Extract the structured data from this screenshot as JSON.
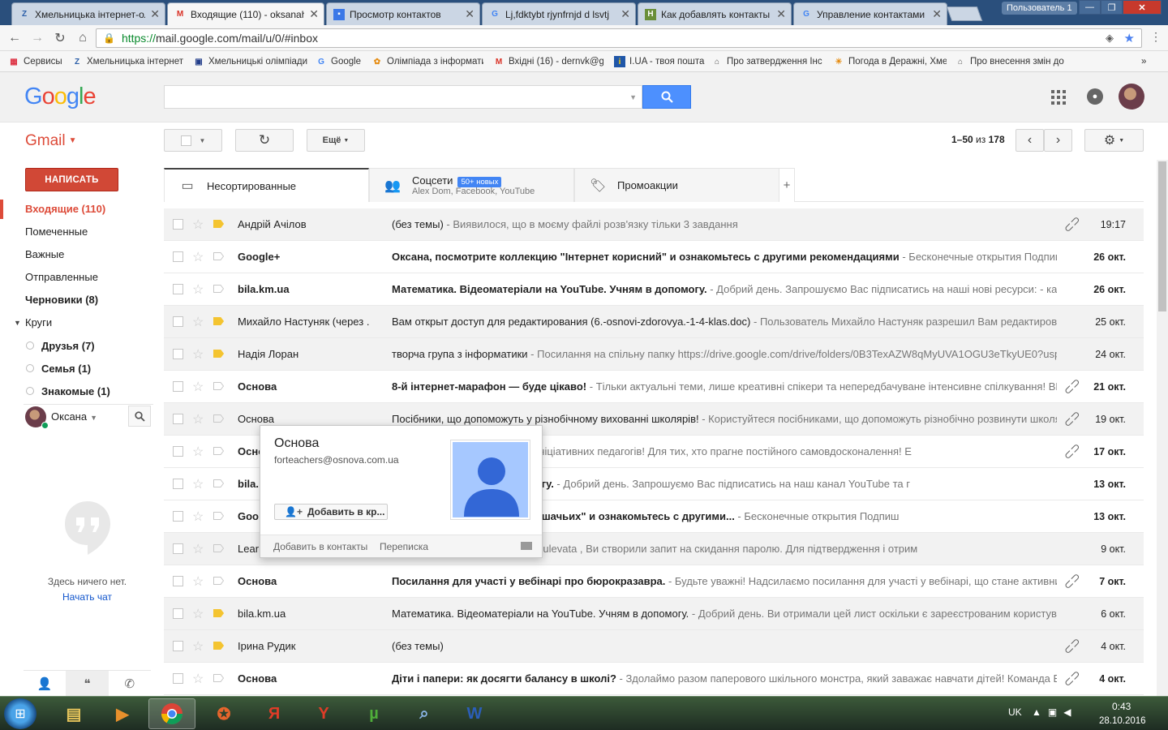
{
  "browser": {
    "tabs": [
      {
        "title": "Хмельницька інтернет-ол",
        "icon": "zo-icon"
      },
      {
        "title": "Входящие (110) - oksanah",
        "icon": "gmail-icon"
      },
      {
        "title": "Просмотр контактов",
        "icon": "contacts-icon"
      },
      {
        "title": "Lj,fdktybt rjynfrnjd d lsvtj",
        "icon": "google-icon"
      },
      {
        "title": "Как добавлять контакты в",
        "icon": "h-icon"
      },
      {
        "title": "Управление контактами -",
        "icon": "google-icon"
      }
    ],
    "user_badge": "Пользователь 1",
    "url_protocol": "https://",
    "url_rest": "mail.google.com/mail/u/0/#inbox",
    "bookmarks": [
      {
        "label": "Сервисы"
      },
      {
        "label": "Хмельницька інтернет"
      },
      {
        "label": "Хмельницькі олімпіади"
      },
      {
        "label": "Google"
      },
      {
        "label": "Олімпіада з інформати"
      },
      {
        "label": "Вхідні (16) - dernvk@gr"
      },
      {
        "label": "I.UA - твоя пошта"
      },
      {
        "label": "Про затвердження Інс"
      },
      {
        "label": "Погода в Деражні, Хме"
      },
      {
        "label": "Про внесення змін до"
      }
    ],
    "bookmarks_more": "»"
  },
  "gmail": {
    "logo": [
      "G",
      "o",
      "o",
      "g",
      "l",
      "e"
    ],
    "product_label": "Gmail",
    "toolbar": {
      "more_label": "Ещё",
      "pagination_range": "1–50",
      "pagination_of": "из",
      "pagination_total": "178"
    },
    "compose_label": "НАПИСАТЬ",
    "nav": [
      {
        "label": "Входящие (110)",
        "state": "active"
      },
      {
        "label": "Помеченные",
        "state": "normal"
      },
      {
        "label": "Важные",
        "state": "normal"
      },
      {
        "label": "Отправленные",
        "state": "normal"
      },
      {
        "label": "Черновики (8)",
        "state": "bold"
      },
      {
        "label": "Круги",
        "state": "normal"
      }
    ],
    "circles": [
      {
        "label": "Друзья (7)"
      },
      {
        "label": "Семья (1)"
      },
      {
        "label": "Знакомые (1)"
      }
    ],
    "hangouts": {
      "user_name": "Оксана",
      "empty_text": "Здесь ничего нет.",
      "start_chat": "Начать чат"
    },
    "category_tabs": [
      {
        "label": "Несортированные",
        "sub": "",
        "badge": "",
        "active": true
      },
      {
        "label": "Соцсети",
        "sub": "Alex Dom, Facebook, YouTube",
        "badge": "50+ новых",
        "active": false
      },
      {
        "label": "Промоакции",
        "sub": "",
        "badge": "",
        "active": false
      }
    ],
    "emails": [
      {
        "sender": "Андрій Ачілов",
        "subject": "(без темы)",
        "snippet": " - Виявилося, що в моєму файлі розв'язку тільки 3 завдання",
        "date": "19:17",
        "unread": false,
        "important": true,
        "attachment": true
      },
      {
        "sender": "Google+",
        "subject": "Оксана, посмотрите коллекцию \"Інтернет корисний\" и ознакомьтесь с другими рекомендациями",
        "snippet": " - Бесконечные открытия Подпиш",
        "date": "26 окт.",
        "unread": true,
        "important": false,
        "attachment": false
      },
      {
        "sender": "bila.km.ua",
        "subject": "Математика. Відеоматеріали на YouTube. Учням в допомогу.",
        "snippet": " - Добрий день. Запрошуємо Вас підписатись на наші нові ресурси: - кан",
        "date": "26 окт.",
        "unread": true,
        "important": false,
        "attachment": false
      },
      {
        "sender": "Михайло Настуняк (через .",
        "subject": "Вам открыт доступ для редактирования (6.-osnovi-zdorovya.-1-4-klas.doc)",
        "snippet": " - Пользователь Михайло Настуняк разрешил Вам редактировать",
        "date": "25 окт.",
        "unread": false,
        "important": true,
        "attachment": false
      },
      {
        "sender": "Надія Лоран",
        "subject": "творча група з інформатики",
        "snippet": " - Посилання на спільну папку https://drive.google.com/drive/folders/0B3TexAZW8qMyUVA1OGU3eTkyUE0?usp=",
        "date": "24 окт.",
        "unread": false,
        "important": true,
        "attachment": false
      },
      {
        "sender": "Основа",
        "subject": "8-й інтернет-марафон — буде цікаво!",
        "snippet": " - Тільки актуальні теми, лише креативні спікери та непередбачуване інтенсивне спілкування! ВГ",
        "date": "21 окт.",
        "unread": true,
        "important": false,
        "attachment": true
      },
      {
        "sender": "Основа",
        "subject": "Посібники, що допоможуть у різнобічному вихованні школярів!",
        "snippet": " - Користуйтеся посібниками, що допоможуть різнобічно розвинути школяр",
        "date": "19 окт.",
        "unread": false,
        "important": false,
        "attachment": true
      },
      {
        "sender": "Осно",
        "subject": "педагогів!",
        "snippet": " - Для сучасних та ініціативних педагогів! Для тих, хто прагне постійного самовдосконалення! Е",
        "date": "17 окт.",
        "unread": true,
        "important": false,
        "attachment": true
      },
      {
        "sender": "bila.",
        "subject": "на YouTube. Учням в допомогу.",
        "snippet": " - Добрий день. Запрошуємо Вас підписатись на наш канал YouTube та г",
        "date": "13 окт.",
        "unread": true,
        "important": false,
        "attachment": false
      },
      {
        "sender": "Goo",
        "subject": "\"Дикие кошки: Семейство кошачьих\" и ознакомьтесь с другими...",
        "snippet": " - Бесконечные открытия Подпиш",
        "date": "13 окт.",
        "unread": true,
        "important": false,
        "attachment": false
      },
      {
        "sender": "Lear",
        "subject": "ль",
        "snippet": " - Доброго дня, oksana2016hulevata , Ви створили запит на скидання паролю. Для підтвердження і отрим",
        "date": "9 окт.",
        "unread": false,
        "important": false,
        "attachment": false
      },
      {
        "sender": "Основа",
        "subject": "Посилання для участі у вебінарі про бюрокразавра.",
        "snippet": " - Будьте уважні! Надсилаємо посилання для участі у вебінарі, що стане активни",
        "date": "7 окт.",
        "unread": true,
        "important": false,
        "attachment": true
      },
      {
        "sender": "bila.km.ua",
        "subject": "Математика. Відеоматеріали на YouTube. Учням в допомогу.",
        "snippet": " - Добрий день. Ви отримали цей лист оскільки є зареєстрованим користува",
        "date": "6 окт.",
        "unread": false,
        "important": true,
        "attachment": false
      },
      {
        "sender": "Ірина Рудик",
        "subject": "(без темы)",
        "snippet": "",
        "date": "4 окт.",
        "unread": false,
        "important": true,
        "attachment": true
      },
      {
        "sender": "Основа",
        "subject": "Діти і папери: як досягти балансу в школі?",
        "snippet": " - Здолаймо разом паперового шкільного монстра, який заважає навчати дітей! Команда Е",
        "date": "4 окт.",
        "unread": true,
        "important": false,
        "attachment": true
      }
    ],
    "hovercard": {
      "name": "Основа",
      "email": "forteachers@osnova.com.ua",
      "add_button": "Добавить в кр...",
      "footer_add": "Добавить в контакты",
      "footer_conversation": "Переписка"
    }
  },
  "taskbar": {
    "lang": "UK",
    "time": "0:43",
    "date": "28.10.2016"
  },
  "colors": {
    "accent_red": "#dd4b39",
    "search_blue": "#4d90fe",
    "important_yellow": "#f4c430"
  }
}
